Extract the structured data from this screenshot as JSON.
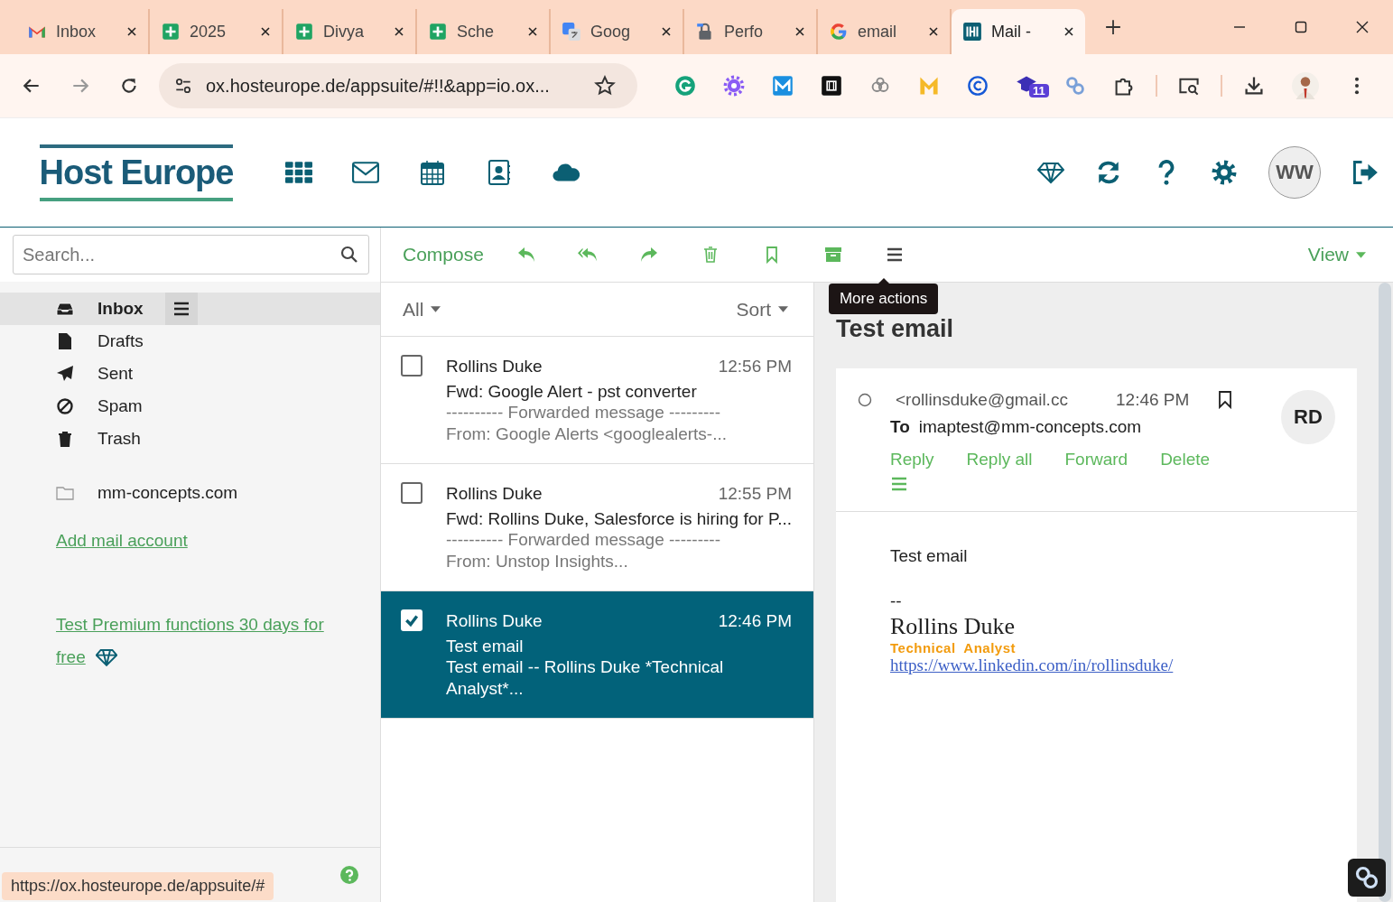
{
  "browser": {
    "tabs": [
      {
        "kind": "gmail",
        "title": "Inbox",
        "selected": false
      },
      {
        "kind": "sheets",
        "title": "2025",
        "selected": false
      },
      {
        "kind": "sheets",
        "title": "Divya",
        "selected": false
      },
      {
        "kind": "sheets",
        "title": "Sche",
        "selected": false
      },
      {
        "kind": "translate",
        "title": "Goog",
        "selected": false
      },
      {
        "kind": "lock",
        "title": "Perfo",
        "selected": false
      },
      {
        "kind": "google",
        "title": "email",
        "selected": false
      },
      {
        "kind": "mail",
        "title": "Mail -",
        "selected": true
      }
    ],
    "address": "ox.hosteurope.de/appsuite/#!!&app=io.ox...",
    "extension_badge": "11"
  },
  "app": {
    "logo": "Host Europe",
    "avatar": "WW"
  },
  "sidebar": {
    "search": {
      "placeholder": "Search..."
    },
    "folders": [
      {
        "kind": "inbox",
        "label": "Inbox",
        "selected": true
      },
      {
        "kind": "drafts",
        "label": "Drafts",
        "selected": false
      },
      {
        "kind": "sent",
        "label": "Sent",
        "selected": false
      },
      {
        "kind": "spam",
        "label": "Spam",
        "selected": false
      },
      {
        "kind": "trash",
        "label": "Trash",
        "selected": false
      }
    ],
    "account": "mm-concepts.com",
    "add_account": "Add mail account",
    "premium_link": "Test Premium functions 30 days for free"
  },
  "toolbar": {
    "compose": "Compose",
    "view": "View",
    "tooltip": "More actions"
  },
  "list": {
    "filter": "All",
    "sort": "Sort",
    "messages": [
      {
        "from": "Rollins Duke",
        "time": "12:56 PM",
        "subject": "Fwd: Google Alert - pst converter",
        "preview": "---------- Forwarded message ---------\nFrom: Google Alerts <googlealerts-...",
        "selected": false
      },
      {
        "from": "Rollins Duke",
        "time": "12:55 PM",
        "subject": "Fwd: Rollins Duke, Salesforce is hiring for P...",
        "preview": "---------- Forwarded message ---------\nFrom: Unstop Insights...",
        "selected": false
      },
      {
        "from": "Rollins Duke",
        "time": "12:46 PM",
        "subject": "Test email",
        "preview": "Test email -- Rollins Duke *Technical\nAnalyst*...",
        "selected": true
      }
    ]
  },
  "detail": {
    "subject": "Test email",
    "from": "<rollinsduke@gmail.cc",
    "time": "12:46 PM",
    "to_label": "To",
    "to": "imaptest@mm-concepts.com",
    "avatar": "RD",
    "actions": [
      "Reply",
      "Reply all",
      "Forward",
      "Delete"
    ],
    "body": "Test email",
    "sig_dash": "--",
    "sig_name": "Rollins Duke",
    "sig_title": "Technical  Analyst",
    "sig_link": "https://www.linkedin.com/in/rollinsduke/"
  },
  "status_url": "https://ox.hosteurope.de/appsuite/#"
}
